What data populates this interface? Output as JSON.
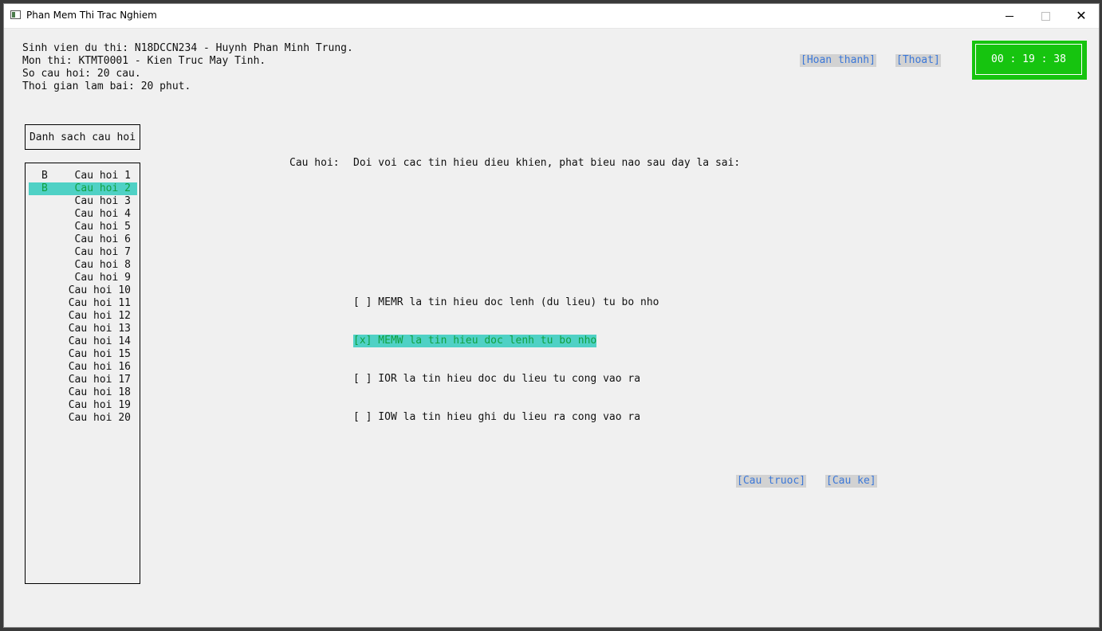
{
  "window": {
    "title": "Phan Mem Thi Trac Nghiem",
    "minimize": "–",
    "maximize": "□",
    "close": "✕"
  },
  "info": {
    "student": "Sinh vien du thi: N18DCCN234 - Huynh Phan Minh Trung.",
    "subject": "Mon thi: KTMT0001 - Kien Truc May Tinh.",
    "question_count": "So cau hoi: 20 cau.",
    "duration": "Thoi gian lam bai: 20 phut."
  },
  "actions": {
    "finish": "[Hoan thanh]",
    "exit": "[Thoat]"
  },
  "timer": {
    "display": "00 : 19 : 38"
  },
  "question_list": {
    "header": "Danh sach cau hoi",
    "items": [
      {
        "answer": "B",
        "label": "Cau hoi 1"
      },
      {
        "answer": "B",
        "label": "Cau hoi 2"
      },
      {
        "answer": "",
        "label": "Cau hoi 3"
      },
      {
        "answer": "",
        "label": "Cau hoi 4"
      },
      {
        "answer": "",
        "label": "Cau hoi 5"
      },
      {
        "answer": "",
        "label": "Cau hoi 6"
      },
      {
        "answer": "",
        "label": "Cau hoi 7"
      },
      {
        "answer": "",
        "label": "Cau hoi 8"
      },
      {
        "answer": "",
        "label": "Cau hoi 9"
      },
      {
        "answer": "",
        "label": "Cau hoi 10"
      },
      {
        "answer": "",
        "label": "Cau hoi 11"
      },
      {
        "answer": "",
        "label": "Cau hoi 12"
      },
      {
        "answer": "",
        "label": "Cau hoi 13"
      },
      {
        "answer": "",
        "label": "Cau hoi 14"
      },
      {
        "answer": "",
        "label": "Cau hoi 15"
      },
      {
        "answer": "",
        "label": "Cau hoi 16"
      },
      {
        "answer": "",
        "label": "Cau hoi 17"
      },
      {
        "answer": "",
        "label": "Cau hoi 18"
      },
      {
        "answer": "",
        "label": "Cau hoi 19"
      },
      {
        "answer": "",
        "label": "Cau hoi 20"
      }
    ],
    "selected_index": 1
  },
  "question": {
    "prompt_label": "Cau hoi:",
    "text": "Doi voi cac tin hieu dieu khien, phat bieu nao sau day la sai:",
    "options": [
      {
        "text": "[ ] MEMR la tin hieu doc lenh (du lieu) tu bo nho",
        "checked": false
      },
      {
        "text": "[x] MEMW la tin hieu doc lenh tu bo nho",
        "checked": true
      },
      {
        "text": "[ ] IOR la tin hieu doc du lieu tu cong vao ra",
        "checked": false
      },
      {
        "text": "[ ] IOW la tin hieu ghi du lieu ra cong vao ra",
        "checked": false
      }
    ]
  },
  "navigation": {
    "prev": "[Cau truoc]",
    "next": "[Cau ke]"
  },
  "colors": {
    "highlight": "#4fd1c5",
    "highlight_text": "#10a040",
    "link": "#3c78d8",
    "timer_bg": "#16c40f"
  }
}
